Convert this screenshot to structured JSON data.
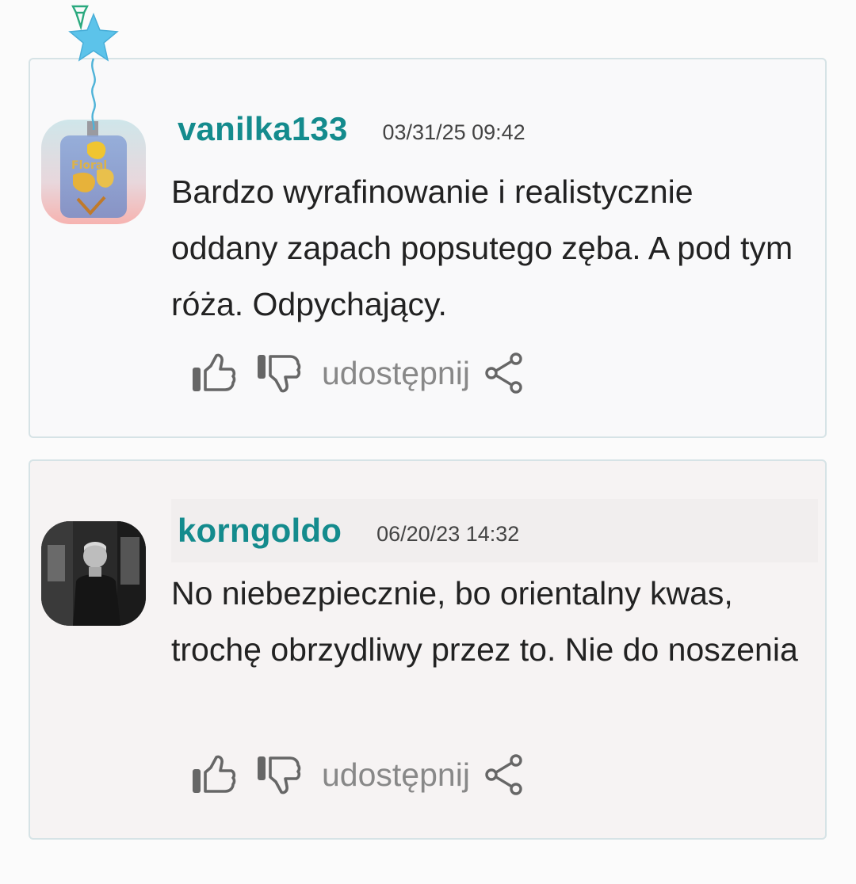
{
  "comments": [
    {
      "username": "vanilka133",
      "date": "03/31/25 09:42",
      "text": "Bardzo wyrafinowanie i realistycznie oddany zapach popsutego zęba. A pod tym róża. Odpychający.",
      "share_label": "udostępnij",
      "avatar_icon": "perfume-bottle-avatar"
    },
    {
      "username": "korngoldo",
      "date": "06/20/23 14:32",
      "text": "No niebezpiecznie, bo orientalny kwas, trochę obrzydliwy przez to. Nie do noszenia",
      "share_label": "udostępnij",
      "avatar_icon": "person-photo-avatar"
    }
  ],
  "icons": {
    "like": "thumbs-up-icon",
    "dislike": "thumbs-down-icon",
    "share": "share-icon",
    "badge": "star-balloon-icon"
  },
  "colors": {
    "username": "#148b8d",
    "icon": "#666666",
    "share_text": "#888888",
    "balloon": "#5cc3ea"
  }
}
